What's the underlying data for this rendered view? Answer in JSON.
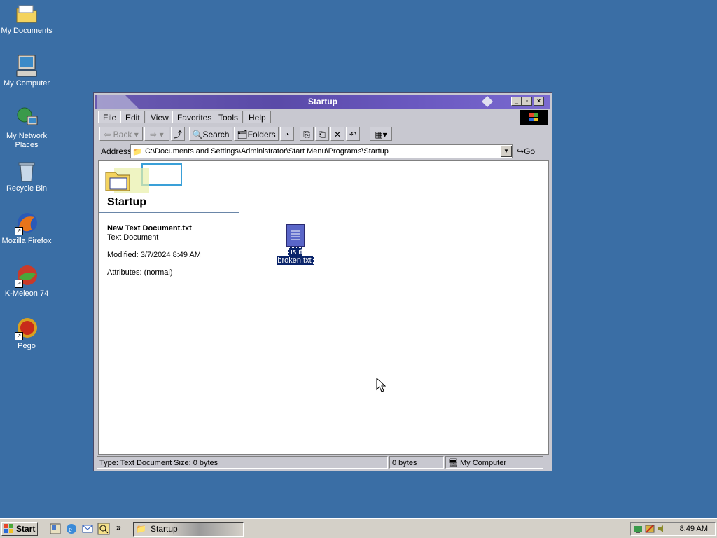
{
  "desktop": {
    "icons": [
      {
        "label": "My Documents"
      },
      {
        "label": "My Computer"
      },
      {
        "label": "My Network Places"
      },
      {
        "label": "Recycle Bin"
      },
      {
        "label": "Mozilla Firefox"
      },
      {
        "label": "K-Meleon 74"
      },
      {
        "label": "Pego"
      }
    ]
  },
  "window": {
    "title": "Startup",
    "menu": [
      "File",
      "Edit",
      "View",
      "Favorites",
      "Tools",
      "Help"
    ],
    "toolbar": {
      "back": "Back",
      "search": "Search",
      "folders": "Folders"
    },
    "address": {
      "label": "Address",
      "value": "C:\\Documents and Settings\\Administrator\\Start Menu\\Programs\\Startup",
      "go": "Go"
    },
    "folder_name": "Startup",
    "selected_info": {
      "name": "New Text Document.txt",
      "type": "Text Document",
      "modified": "Modified: 3/7/2024 8:49 AM",
      "attributes": "Attributes: (normal)"
    },
    "files": [
      {
        "label": "is it broken.txt",
        "icon": "text-document-icon"
      }
    ],
    "status": {
      "left": "Type: Text Document Size: 0 bytes",
      "size": "0 bytes",
      "zone": "My Computer"
    }
  },
  "taskbar": {
    "start": "Start",
    "task": "Startup",
    "clock": "8:49 AM"
  },
  "colors": {
    "desktop": "#3a6ea5",
    "titlebar": "#5a4aa8",
    "selection": "#0a246a"
  }
}
